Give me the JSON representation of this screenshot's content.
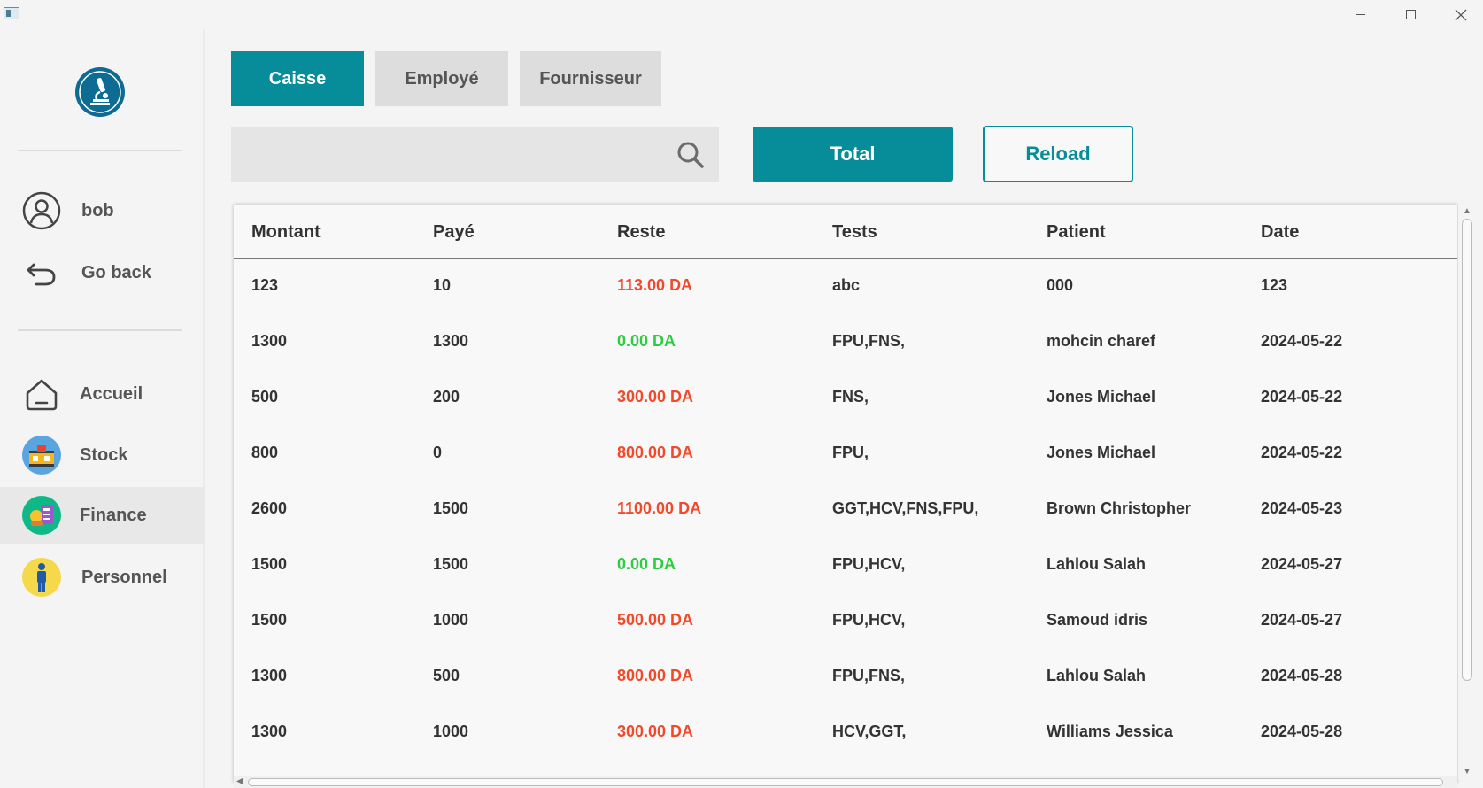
{
  "window": {
    "controls": {
      "minimize": "minimize-icon",
      "maximize": "maximize-icon",
      "close": "close-icon"
    }
  },
  "sidebar": {
    "user": {
      "name": "bob",
      "icon": "user-circle-icon"
    },
    "go_back": {
      "label": "Go back",
      "icon": "undo-arrow-icon"
    },
    "nav": [
      {
        "label": "Accueil",
        "icon": "home-icon"
      },
      {
        "label": "Stock",
        "icon": "stock-icon"
      },
      {
        "label": "Finance",
        "icon": "finance-icon",
        "active": true
      },
      {
        "label": "Personnel",
        "icon": "personnel-icon"
      }
    ]
  },
  "tabs": [
    {
      "label": "Caisse",
      "active": true
    },
    {
      "label": "Employé",
      "active": false
    },
    {
      "label": "Fournisseur",
      "active": false
    }
  ],
  "search": {
    "value": "",
    "placeholder": ""
  },
  "buttons": {
    "total": "Total",
    "reload": "Reload"
  },
  "table": {
    "columns": [
      "Montant",
      "Payé",
      "Reste",
      "Tests",
      "Patient",
      "Date"
    ],
    "rows": [
      [
        "123",
        "10",
        "113.00 DA",
        "abc",
        "000",
        "123"
      ],
      [
        "1300",
        "1300",
        "0.00 DA",
        "FPU,FNS,",
        "mohcin charef",
        "2024-05-22"
      ],
      [
        "500",
        "200",
        "300.00 DA",
        "FNS,",
        "Jones Michael",
        "2024-05-22"
      ],
      [
        "800",
        "0",
        "800.00 DA",
        "FPU,",
        "Jones Michael",
        "2024-05-22"
      ],
      [
        "2600",
        "1500",
        "1100.00 DA",
        "GGT,HCV,FNS,FPU,",
        "Brown Christopher",
        "2024-05-23"
      ],
      [
        "1500",
        "1500",
        "0.00 DA",
        "FPU,HCV,",
        "Lahlou Salah",
        "2024-05-27"
      ],
      [
        "1500",
        "1000",
        "500.00 DA",
        "FPU,HCV,",
        "Samoud idris",
        "2024-05-27"
      ],
      [
        "1300",
        "500",
        "800.00 DA",
        "FPU,FNS,",
        "Lahlou Salah",
        "2024-05-28"
      ],
      [
        "1300",
        "1000",
        "300.00 DA",
        "HCV,GGT,",
        "Williams Jessica",
        "2024-05-28"
      ]
    ]
  },
  "colors": {
    "accent": "#078d9a",
    "owed": "#f1492a",
    "paid": "#2ecc40"
  }
}
